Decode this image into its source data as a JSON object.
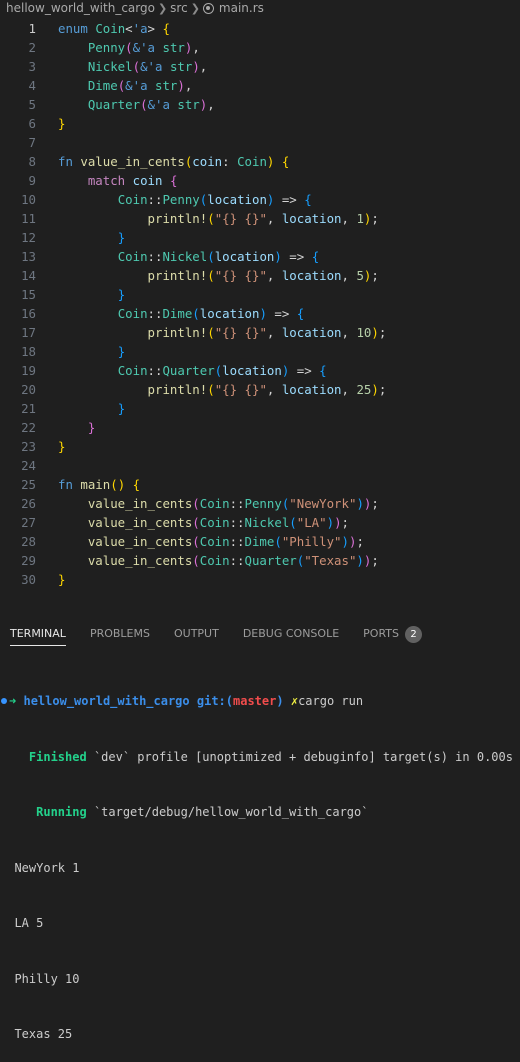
{
  "breadcrumb": {
    "project": "hellow_world_with_cargo",
    "folder": "src",
    "file": "main.rs"
  },
  "editor": {
    "active_line": 1,
    "lines": [
      {
        "n": "1",
        "indent": "",
        "tokens": [
          {
            "t": "enum",
            "c": "kw"
          },
          {
            "t": " "
          },
          {
            "t": "Coin",
            "c": "ty"
          },
          {
            "t": "<",
            "c": "p"
          },
          {
            "t": "'a",
            "c": "lt"
          },
          {
            "t": ">",
            "c": "p"
          },
          {
            "t": " "
          },
          {
            "t": "{",
            "c": "b1"
          }
        ]
      },
      {
        "n": "2",
        "indent": "    ",
        "tokens": [
          {
            "t": "Penny",
            "c": "ty"
          },
          {
            "t": "(",
            "c": "b2"
          },
          {
            "t": "&",
            "c": "kw"
          },
          {
            "t": "'a",
            "c": "lt"
          },
          {
            "t": " "
          },
          {
            "t": "str",
            "c": "ty"
          },
          {
            "t": ")",
            "c": "b2"
          },
          {
            "t": ",",
            "c": "p"
          }
        ]
      },
      {
        "n": "3",
        "indent": "    ",
        "tokens": [
          {
            "t": "Nickel",
            "c": "ty"
          },
          {
            "t": "(",
            "c": "b2"
          },
          {
            "t": "&",
            "c": "kw"
          },
          {
            "t": "'a",
            "c": "lt"
          },
          {
            "t": " "
          },
          {
            "t": "str",
            "c": "ty"
          },
          {
            "t": ")",
            "c": "b2"
          },
          {
            "t": ",",
            "c": "p"
          }
        ]
      },
      {
        "n": "4",
        "indent": "    ",
        "tokens": [
          {
            "t": "Dime",
            "c": "ty"
          },
          {
            "t": "(",
            "c": "b2"
          },
          {
            "t": "&",
            "c": "kw"
          },
          {
            "t": "'a",
            "c": "lt"
          },
          {
            "t": " "
          },
          {
            "t": "str",
            "c": "ty"
          },
          {
            "t": ")",
            "c": "b2"
          },
          {
            "t": ",",
            "c": "p"
          }
        ]
      },
      {
        "n": "5",
        "indent": "    ",
        "tokens": [
          {
            "t": "Quarter",
            "c": "ty"
          },
          {
            "t": "(",
            "c": "b2"
          },
          {
            "t": "&",
            "c": "kw"
          },
          {
            "t": "'a",
            "c": "lt"
          },
          {
            "t": " "
          },
          {
            "t": "str",
            "c": "ty"
          },
          {
            "t": ")",
            "c": "b2"
          },
          {
            "t": ",",
            "c": "p"
          }
        ]
      },
      {
        "n": "6",
        "indent": "",
        "tokens": [
          {
            "t": "}",
            "c": "b1"
          }
        ]
      },
      {
        "n": "7",
        "indent": "",
        "tokens": []
      },
      {
        "n": "8",
        "indent": "",
        "tokens": [
          {
            "t": "fn",
            "c": "kw"
          },
          {
            "t": " "
          },
          {
            "t": "value_in_cents",
            "c": "fn"
          },
          {
            "t": "(",
            "c": "b1"
          },
          {
            "t": "coin",
            "c": "var"
          },
          {
            "t": ": ",
            "c": "p"
          },
          {
            "t": "Coin",
            "c": "ty"
          },
          {
            "t": ")",
            "c": "b1"
          },
          {
            "t": " "
          },
          {
            "t": "{",
            "c": "b1"
          }
        ]
      },
      {
        "n": "9",
        "indent": "    ",
        "tokens": [
          {
            "t": "match",
            "c": "ctl"
          },
          {
            "t": " "
          },
          {
            "t": "coin",
            "c": "var"
          },
          {
            "t": " "
          },
          {
            "t": "{",
            "c": "b2"
          }
        ]
      },
      {
        "n": "10",
        "indent": "        ",
        "tokens": [
          {
            "t": "Coin",
            "c": "ty"
          },
          {
            "t": "::",
            "c": "p"
          },
          {
            "t": "Penny",
            "c": "ty"
          },
          {
            "t": "(",
            "c": "b3"
          },
          {
            "t": "location",
            "c": "var"
          },
          {
            "t": ")",
            "c": "b3"
          },
          {
            "t": " => ",
            "c": "p"
          },
          {
            "t": "{",
            "c": "b3"
          }
        ]
      },
      {
        "n": "11",
        "indent": "            ",
        "tokens": [
          {
            "t": "println!",
            "c": "fn"
          },
          {
            "t": "(",
            "c": "b1"
          },
          {
            "t": "\"{} {}\"",
            "c": "str"
          },
          {
            "t": ", ",
            "c": "p"
          },
          {
            "t": "location",
            "c": "var"
          },
          {
            "t": ", ",
            "c": "p"
          },
          {
            "t": "1",
            "c": "num"
          },
          {
            "t": ")",
            "c": "b1"
          },
          {
            "t": ";",
            "c": "p"
          }
        ]
      },
      {
        "n": "12",
        "indent": "        ",
        "tokens": [
          {
            "t": "}",
            "c": "b3"
          }
        ]
      },
      {
        "n": "13",
        "indent": "        ",
        "tokens": [
          {
            "t": "Coin",
            "c": "ty"
          },
          {
            "t": "::",
            "c": "p"
          },
          {
            "t": "Nickel",
            "c": "ty"
          },
          {
            "t": "(",
            "c": "b3"
          },
          {
            "t": "location",
            "c": "var"
          },
          {
            "t": ")",
            "c": "b3"
          },
          {
            "t": " => ",
            "c": "p"
          },
          {
            "t": "{",
            "c": "b3"
          }
        ]
      },
      {
        "n": "14",
        "indent": "            ",
        "tokens": [
          {
            "t": "println!",
            "c": "fn"
          },
          {
            "t": "(",
            "c": "b1"
          },
          {
            "t": "\"{} {}\"",
            "c": "str"
          },
          {
            "t": ", ",
            "c": "p"
          },
          {
            "t": "location",
            "c": "var"
          },
          {
            "t": ", ",
            "c": "p"
          },
          {
            "t": "5",
            "c": "num"
          },
          {
            "t": ")",
            "c": "b1"
          },
          {
            "t": ";",
            "c": "p"
          }
        ]
      },
      {
        "n": "15",
        "indent": "        ",
        "tokens": [
          {
            "t": "}",
            "c": "b3"
          }
        ]
      },
      {
        "n": "16",
        "indent": "        ",
        "tokens": [
          {
            "t": "Coin",
            "c": "ty"
          },
          {
            "t": "::",
            "c": "p"
          },
          {
            "t": "Dime",
            "c": "ty"
          },
          {
            "t": "(",
            "c": "b3"
          },
          {
            "t": "location",
            "c": "var"
          },
          {
            "t": ")",
            "c": "b3"
          },
          {
            "t": " => ",
            "c": "p"
          },
          {
            "t": "{",
            "c": "b3"
          }
        ]
      },
      {
        "n": "17",
        "indent": "            ",
        "tokens": [
          {
            "t": "println!",
            "c": "fn"
          },
          {
            "t": "(",
            "c": "b1"
          },
          {
            "t": "\"{} {}\"",
            "c": "str"
          },
          {
            "t": ", ",
            "c": "p"
          },
          {
            "t": "location",
            "c": "var"
          },
          {
            "t": ", ",
            "c": "p"
          },
          {
            "t": "10",
            "c": "num"
          },
          {
            "t": ")",
            "c": "b1"
          },
          {
            "t": ";",
            "c": "p"
          }
        ]
      },
      {
        "n": "18",
        "indent": "        ",
        "tokens": [
          {
            "t": "}",
            "c": "b3"
          }
        ]
      },
      {
        "n": "19",
        "indent": "        ",
        "tokens": [
          {
            "t": "Coin",
            "c": "ty"
          },
          {
            "t": "::",
            "c": "p"
          },
          {
            "t": "Quarter",
            "c": "ty"
          },
          {
            "t": "(",
            "c": "b3"
          },
          {
            "t": "location",
            "c": "var"
          },
          {
            "t": ")",
            "c": "b3"
          },
          {
            "t": " => ",
            "c": "p"
          },
          {
            "t": "{",
            "c": "b3"
          }
        ]
      },
      {
        "n": "20",
        "indent": "            ",
        "tokens": [
          {
            "t": "println!",
            "c": "fn"
          },
          {
            "t": "(",
            "c": "b1"
          },
          {
            "t": "\"{} {}\"",
            "c": "str"
          },
          {
            "t": ", ",
            "c": "p"
          },
          {
            "t": "location",
            "c": "var"
          },
          {
            "t": ", ",
            "c": "p"
          },
          {
            "t": "25",
            "c": "num"
          },
          {
            "t": ")",
            "c": "b1"
          },
          {
            "t": ";",
            "c": "p"
          }
        ]
      },
      {
        "n": "21",
        "indent": "        ",
        "tokens": [
          {
            "t": "}",
            "c": "b3"
          }
        ]
      },
      {
        "n": "22",
        "indent": "    ",
        "tokens": [
          {
            "t": "}",
            "c": "b2"
          }
        ]
      },
      {
        "n": "23",
        "indent": "",
        "tokens": [
          {
            "t": "}",
            "c": "b1"
          }
        ]
      },
      {
        "n": "24",
        "indent": "",
        "tokens": []
      },
      {
        "n": "25",
        "indent": "",
        "tokens": [
          {
            "t": "fn",
            "c": "kw"
          },
          {
            "t": " "
          },
          {
            "t": "main",
            "c": "fn"
          },
          {
            "t": "()",
            "c": "b1"
          },
          {
            "t": " "
          },
          {
            "t": "{",
            "c": "b1"
          }
        ]
      },
      {
        "n": "26",
        "indent": "    ",
        "tokens": [
          {
            "t": "value_in_cents",
            "c": "fn"
          },
          {
            "t": "(",
            "c": "b2"
          },
          {
            "t": "Coin",
            "c": "ty"
          },
          {
            "t": "::",
            "c": "p"
          },
          {
            "t": "Penny",
            "c": "ty"
          },
          {
            "t": "(",
            "c": "b3"
          },
          {
            "t": "\"NewYork\"",
            "c": "str"
          },
          {
            "t": ")",
            "c": "b3"
          },
          {
            "t": ")",
            "c": "b2"
          },
          {
            "t": ";",
            "c": "p"
          }
        ]
      },
      {
        "n": "27",
        "indent": "    ",
        "tokens": [
          {
            "t": "value_in_cents",
            "c": "fn"
          },
          {
            "t": "(",
            "c": "b2"
          },
          {
            "t": "Coin",
            "c": "ty"
          },
          {
            "t": "::",
            "c": "p"
          },
          {
            "t": "Nickel",
            "c": "ty"
          },
          {
            "t": "(",
            "c": "b3"
          },
          {
            "t": "\"LA\"",
            "c": "str"
          },
          {
            "t": ")",
            "c": "b3"
          },
          {
            "t": ")",
            "c": "b2"
          },
          {
            "t": ";",
            "c": "p"
          }
        ]
      },
      {
        "n": "28",
        "indent": "    ",
        "tokens": [
          {
            "t": "value_in_cents",
            "c": "fn"
          },
          {
            "t": "(",
            "c": "b2"
          },
          {
            "t": "Coin",
            "c": "ty"
          },
          {
            "t": "::",
            "c": "p"
          },
          {
            "t": "Dime",
            "c": "ty"
          },
          {
            "t": "(",
            "c": "b3"
          },
          {
            "t": "\"Philly\"",
            "c": "str"
          },
          {
            "t": ")",
            "c": "b3"
          },
          {
            "t": ")",
            "c": "b2"
          },
          {
            "t": ";",
            "c": "p"
          }
        ]
      },
      {
        "n": "29",
        "indent": "    ",
        "tokens": [
          {
            "t": "value_in_cents",
            "c": "fn"
          },
          {
            "t": "(",
            "c": "b2"
          },
          {
            "t": "Coin",
            "c": "ty"
          },
          {
            "t": "::",
            "c": "p"
          },
          {
            "t": "Quarter",
            "c": "ty"
          },
          {
            "t": "(",
            "c": "b3"
          },
          {
            "t": "\"Texas\"",
            "c": "str"
          },
          {
            "t": ")",
            "c": "b3"
          },
          {
            "t": ")",
            "c": "b2"
          },
          {
            "t": ";",
            "c": "p"
          }
        ]
      },
      {
        "n": "30",
        "indent": "",
        "tokens": [
          {
            "t": "}",
            "c": "b1"
          }
        ]
      }
    ]
  },
  "panel": {
    "tabs": [
      {
        "label": "TERMINAL",
        "active": true
      },
      {
        "label": "PROBLEMS",
        "active": false
      },
      {
        "label": "OUTPUT",
        "active": false
      },
      {
        "label": "DEBUG CONSOLE",
        "active": false
      },
      {
        "label": "PORTS",
        "active": false,
        "badge": "2"
      }
    ]
  },
  "terminal": {
    "prompt_arrow": "➜",
    "repo": "hellow_world_with_cargo",
    "git_prefix": "git:(",
    "branch": "master",
    "git_suffix": ")",
    "dirty_mark": "✗",
    "command": "cargo run",
    "finished_label": "Finished",
    "finished_text": "`dev` profile [unoptimized + debuginfo] target(s) in 0.00s",
    "running_label": "Running",
    "running_text": "`target/debug/hellow_world_with_cargo`",
    "output": [
      "NewYork 1",
      "LA 5",
      "Philly 10",
      "Texas 25"
    ]
  }
}
